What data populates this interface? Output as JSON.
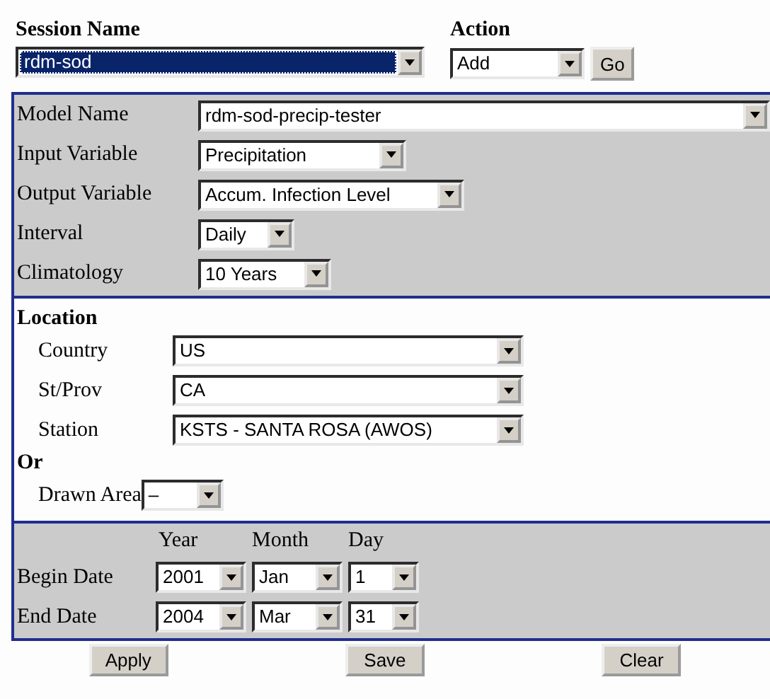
{
  "session": {
    "label": "Session Name",
    "value": "rdm-sod",
    "focused": true
  },
  "action": {
    "label": "Action",
    "value": "Add",
    "button": "Go"
  },
  "model_fields": [
    {
      "label": "Model Name",
      "value": "rdm-sod-precip-tester"
    },
    {
      "label": "Input Variable",
      "value": "Precipitation"
    },
    {
      "label": "Output Variable",
      "value": "Accum. Infection Level"
    },
    {
      "label": "Interval",
      "value": "Daily"
    },
    {
      "label": "Climatology",
      "value": "10 Years"
    }
  ],
  "location": {
    "heading": "Location",
    "fields": [
      {
        "label": "Country",
        "value": "US"
      },
      {
        "label": "St/Prov",
        "value": "CA"
      },
      {
        "label": "Station",
        "value": "KSTS - SANTA ROSA (AWOS)"
      }
    ]
  },
  "alternative": {
    "heading": "Or",
    "fields": [
      {
        "label": "Drawn Area",
        "value": "–"
      }
    ]
  },
  "dates": {
    "columns": [
      "Year",
      "Month",
      "Day"
    ],
    "rows": [
      {
        "label": "Begin Date",
        "values": [
          "2001",
          "Jan",
          "1"
        ]
      },
      {
        "label": "End Date",
        "values": [
          "2004",
          "Mar",
          "31"
        ]
      }
    ]
  },
  "buttons": [
    "Apply",
    "Save",
    "Clear"
  ]
}
